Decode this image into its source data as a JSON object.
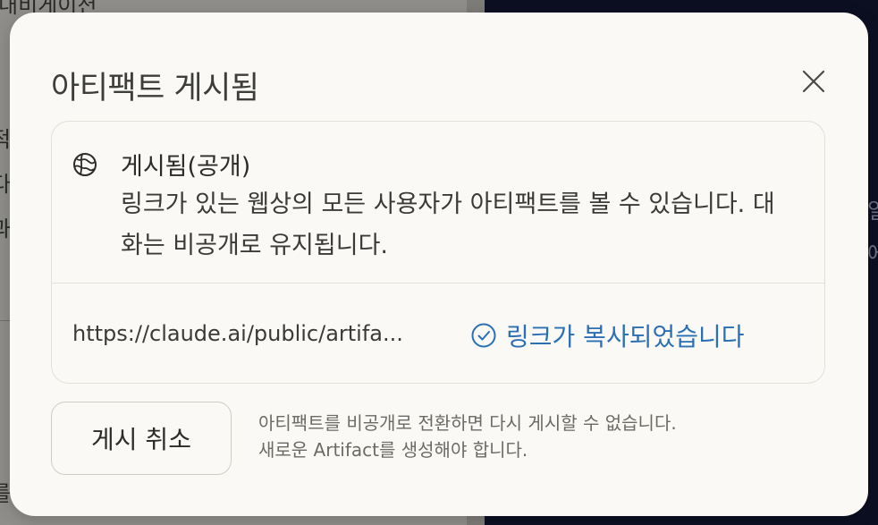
{
  "background": {
    "left_fragments": [
      "내비게이션",
      "적",
      "다",
      "과",
      "를"
    ],
    "right_fragments": [
      "일",
      "에"
    ]
  },
  "dialog": {
    "title": "아티팩트 게시됨",
    "close_icon": "close-icon",
    "status": {
      "icon": "globe-icon",
      "title": "게시됨(공개)",
      "description": "링크가 있는 웹상의 모든 사용자가 아티팩트를 볼 수 있습니다. 대화는 비공개로 유지됩니다."
    },
    "link": {
      "url": "https://claude.ai/public/artifa...",
      "copied_icon": "check-circle-icon",
      "copied_label": "링크가 복사되었습니다"
    },
    "unpublish_label": "게시 취소",
    "warning_lines": [
      "아티팩트를 비공개로 전환하면 다시 게시할 수 없습니다.",
      "새로운 Artifact를 생성해야 합니다."
    ]
  },
  "colors": {
    "modal_bg": "#faf9f5",
    "accent_blue": "#2b6fb5",
    "text_primary": "#2b2b29",
    "text_muted": "#6b6a65",
    "border": "#e2e0d9",
    "backdrop_right": "#0c0f22"
  }
}
